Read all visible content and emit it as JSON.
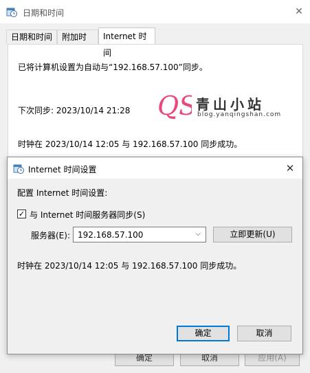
{
  "outer_window": {
    "title": "日期和时间",
    "tabs": [
      {
        "label": "日期和时间",
        "active": false
      },
      {
        "label": "附加时钟",
        "active": false
      },
      {
        "label": "Internet 时间",
        "active": true
      }
    ],
    "line1": "已将计算机设置为自动与“192.168.57.100”同步。",
    "next_sync": "下次同步: 2023/10/14 21:28",
    "last_sync": "时钟在 2023/10/14 12:05 与 192.168.57.100 同步成功。",
    "buttons": {
      "ok": "确定",
      "cancel": "取消",
      "apply": "应用(A)"
    }
  },
  "watermark": {
    "logo_text": "QS",
    "title": "青山小站",
    "url": "blog.yanqingshan.com"
  },
  "dialog": {
    "title": "Internet 时间设置",
    "heading": "配置 Internet 时间设置:",
    "sync_checkbox_label": "与 Internet 时间服务器同步(S)",
    "sync_checked": true,
    "server_label": "服务器(E):",
    "server_value": "192.168.57.100",
    "update_button": "立即更新(U)",
    "status": "时钟在 2023/10/14 12:05 与 192.168.57.100 同步成功。",
    "ok": "确定",
    "cancel": "取消"
  },
  "colors": {
    "accent": "#0078d7",
    "watermark_logo": "#e8487a"
  }
}
